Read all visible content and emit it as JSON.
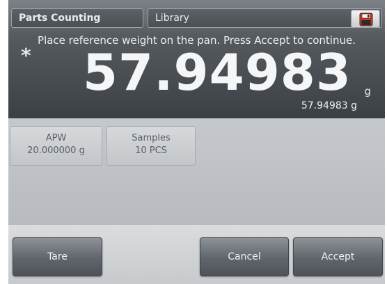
{
  "header": {
    "mode_tab": "Parts Counting",
    "library_tab": "Library",
    "save_icon": "floppy-disk-icon"
  },
  "display": {
    "message": "Place reference weight on the pan.  Press Accept to continue.",
    "stable_indicator": "*",
    "main_value": "57.94983",
    "main_unit": "g",
    "secondary_value": "57.94983 g"
  },
  "params": {
    "apw_label": "APW",
    "apw_value": "20.000000 g",
    "samples_label": "Samples",
    "samples_value": "10 PCS"
  },
  "footer": {
    "tare_label": "Tare",
    "cancel_label": "Cancel",
    "accept_label": "Accept"
  },
  "colors": {
    "display_bg": "#4a4f54",
    "body_bg": "#bfc3c6",
    "button_bg": "#6a7075",
    "text_light": "#f4f6f7"
  }
}
